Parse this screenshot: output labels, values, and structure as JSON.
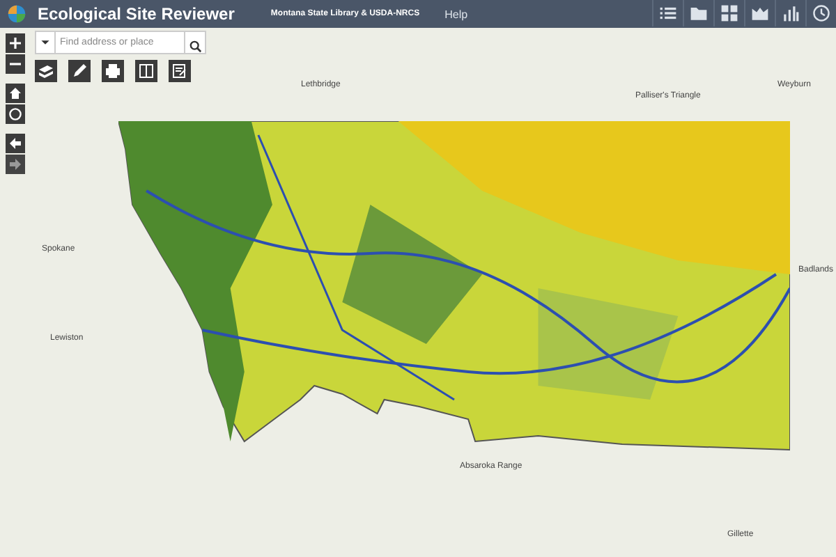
{
  "header": {
    "title": "Ecological Site Reviewer",
    "credit": "Montana State Library & USDA-NRCS",
    "help": "Help"
  },
  "search": {
    "placeholder": "Find address or place"
  },
  "map_labels": [
    "Lethbridge",
    "Palliser's Triangle",
    "Weyburn",
    "Spokane",
    "Lewiston",
    "Badlands",
    "Absaroka Range",
    "Gillette"
  ]
}
